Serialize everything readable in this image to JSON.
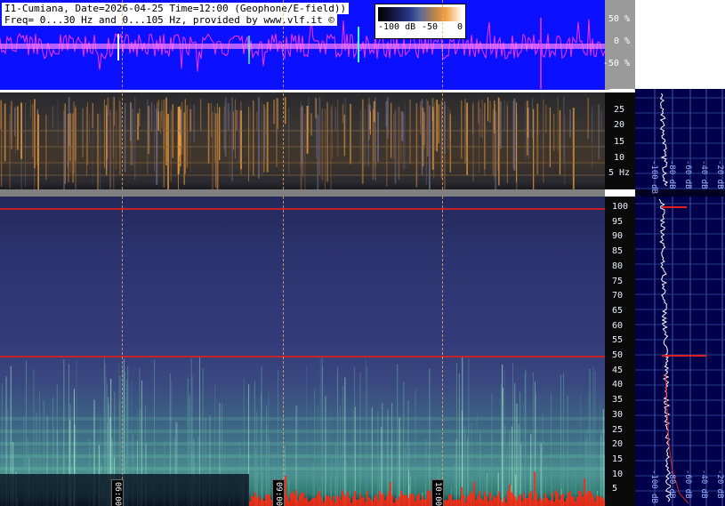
{
  "header": {
    "title_line1": "I1-Cumiana, Date=2026-04-25 Time=12:00 (Geophone/E-field))",
    "title_line2": "Freq= 0...30 Hz and 0...105 Hz, provided by www.vlf.it ©"
  },
  "colorbar": {
    "labels": [
      "-100 dB",
      "-50",
      "0"
    ]
  },
  "wave_axis": {
    "labels": [
      "50 %",
      "0 %",
      "-50 %"
    ]
  },
  "low_freq_axis": {
    "labels": [
      "25",
      "20",
      "15",
      "10",
      "5 Hz"
    ]
  },
  "high_freq_axis": {
    "labels": [
      "100",
      "95",
      "90",
      "85",
      "80",
      "75",
      "70",
      "65",
      "60",
      "55",
      "50",
      "45",
      "40",
      "35",
      "30",
      "25",
      "20",
      "15",
      "10",
      "5"
    ]
  },
  "side_panel": {
    "top_db_labels": [
      "-100 dB",
      "-80 dB",
      "-60 dB",
      "-40 dB",
      "-20 dB"
    ],
    "bottom_db_labels": [
      "-100 dB",
      "-80 dB",
      "-60 dB",
      "-40 dB",
      "-20 dB"
    ]
  },
  "time_markers": [
    "06:00",
    "09:00",
    "10:00"
  ],
  "colors": {
    "wave_bg": "#0b10ff",
    "wave_trace": "#ff30ff",
    "side_bg": "#00004a",
    "mains_line": "#e0201c"
  }
}
